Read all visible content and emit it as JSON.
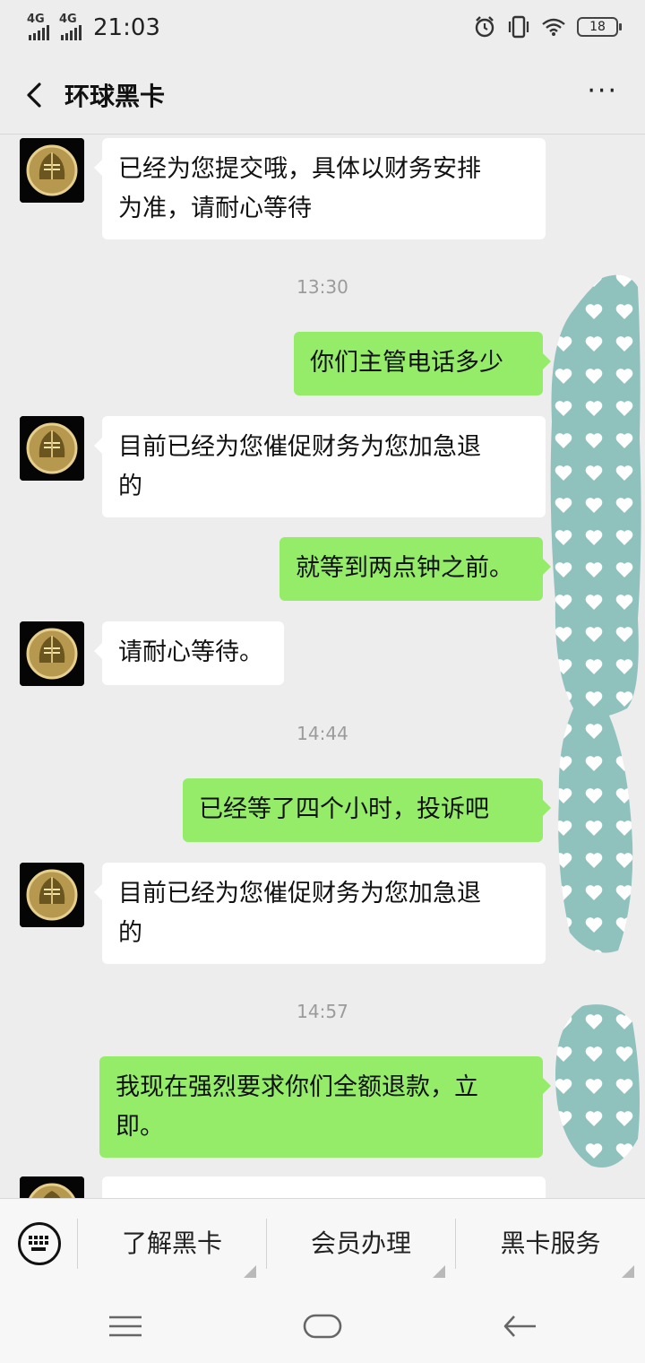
{
  "status_bar": {
    "signal_1": "4G",
    "signal_2": "4G",
    "time": "21:03",
    "battery": "18",
    "icons": [
      "alarm-icon",
      "vibrate-icon",
      "wifi-icon",
      "battery-icon"
    ]
  },
  "header": {
    "title": "环球黑卡",
    "more": "···"
  },
  "messages": [
    {
      "type": "in",
      "lines": [
        "已经为您提交哦，具体以财务安排",
        "为准，请耐心等待"
      ]
    },
    {
      "type": "time",
      "text": "13:30"
    },
    {
      "type": "out",
      "lines": [
        "你们主管电话多少"
      ]
    },
    {
      "type": "in",
      "lines": [
        "目前已经为您催促财务为您加急退",
        "的"
      ]
    },
    {
      "type": "out",
      "lines": [
        "就等到两点钟之前。"
      ]
    },
    {
      "type": "in",
      "lines": [
        "请耐心等待。"
      ]
    },
    {
      "type": "time",
      "text": "14:44"
    },
    {
      "type": "out",
      "lines": [
        "已经等了四个小时，投诉吧"
      ]
    },
    {
      "type": "in",
      "lines": [
        "目前已经为您催促财务为您加急退",
        "的"
      ]
    },
    {
      "type": "time",
      "text": "14:57"
    },
    {
      "type": "out",
      "lines": [
        "我现在强烈要求你们全额退款，立",
        "即。"
      ]
    }
  ],
  "menu": {
    "items": [
      "了解黑卡",
      "会员办理",
      "黑卡服务"
    ]
  },
  "colors": {
    "background": "#ededed",
    "outgoing_bubble": "#95ec69",
    "incoming_bubble": "#ffffff",
    "blur_overlay": "#8fc1bd"
  }
}
